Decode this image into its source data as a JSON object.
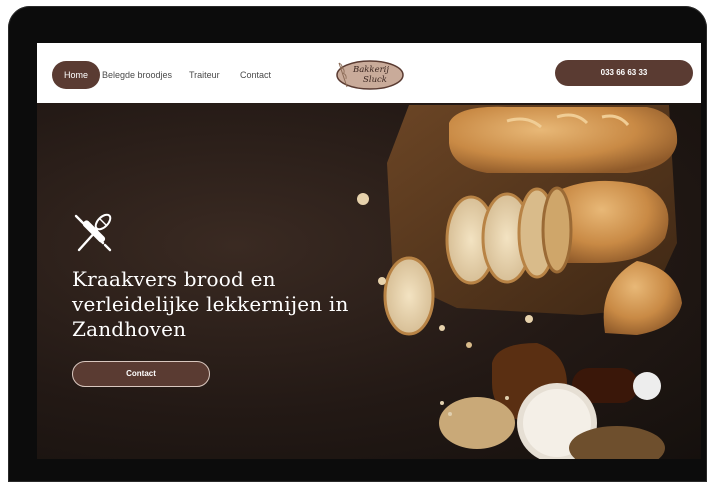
{
  "nav": {
    "home_label": "Home",
    "items": [
      "Belegde broodjes",
      "Traiteur",
      "Contact"
    ],
    "logo_text_line1": "Bakkerij",
    "logo_text_line2": "Sluck",
    "phone_label": "033 66 63 33"
  },
  "hero": {
    "title": "Kraakvers brood en verleidelijke lekkernijen in Zandhoven",
    "cta_label": "Contact",
    "icon": "rolling-pin-whisk-icon"
  },
  "colors": {
    "accent": "#5a3b32",
    "hero_background": "#231915",
    "header_background": "#ffffff"
  }
}
